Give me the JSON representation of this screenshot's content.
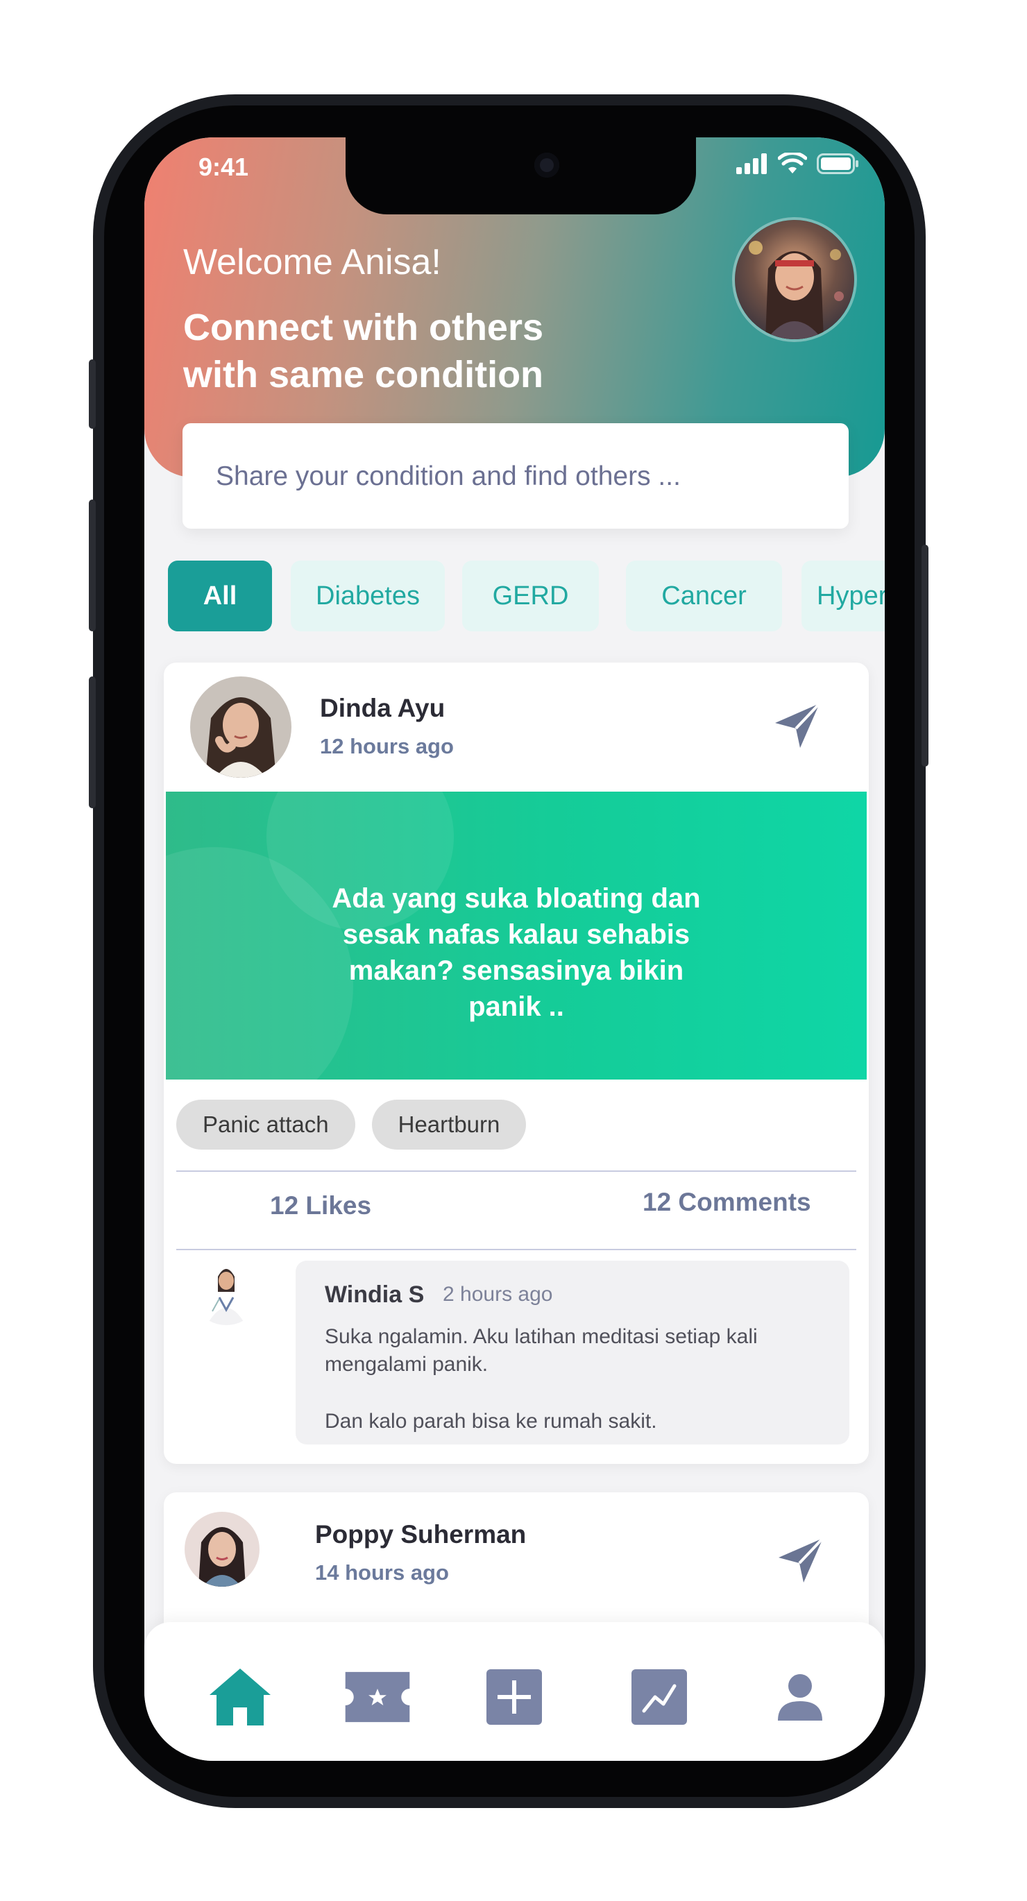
{
  "status_bar": {
    "time": "9:41"
  },
  "header": {
    "welcome": "Welcome Anisa!",
    "headline": "Connect with others with same condition"
  },
  "search": {
    "placeholder": "Share your condition and find others ..."
  },
  "filters": [
    "All",
    "Diabetes",
    "GERD",
    "Cancer",
    "Hyper"
  ],
  "posts": [
    {
      "author": "Dinda Ayu",
      "time": "12 hours ago",
      "content": "Ada yang suka bloating dan sesak nafas kalau sehabis makan? sensasinya bikin panik ..",
      "tags": [
        "Panic attach",
        "Heartburn"
      ],
      "likes": "12 Likes",
      "comments_count": "12 Comments",
      "top_comment": {
        "author": "Windia S",
        "time": "2 hours ago",
        "text": "Suka ngalamin. Aku latihan meditasi setiap kali mengalami panik.",
        "text2": "Dan kalo parah bisa ke rumah sakit."
      }
    },
    {
      "author": "Poppy Suherman",
      "time": "14 hours ago"
    }
  ],
  "nav": [
    {
      "icon": "home-icon",
      "active": true
    },
    {
      "icon": "ticket-icon",
      "active": false
    },
    {
      "icon": "add-icon",
      "active": false
    },
    {
      "icon": "chart-icon",
      "active": false
    },
    {
      "icon": "profile-icon",
      "active": false
    }
  ],
  "colors": {
    "accent": "#1a9e98",
    "chip_bg": "#e5f6f4",
    "banner": "#15cc98",
    "nav_inactive": "#7a84a6"
  }
}
